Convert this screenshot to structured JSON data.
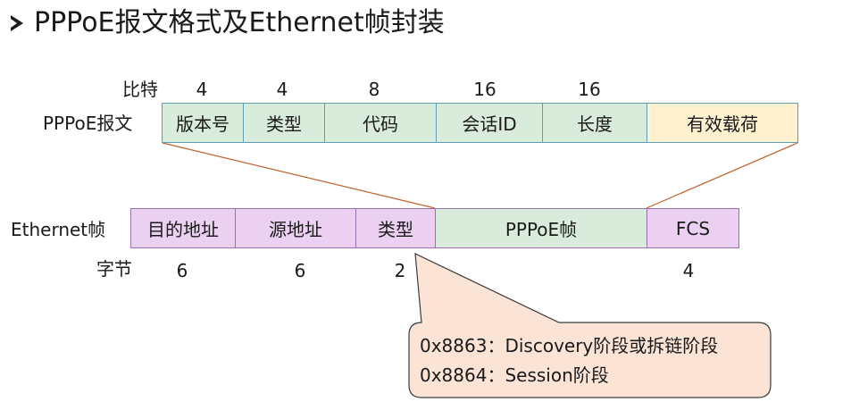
{
  "title": "PPPoE报文格式及Ethernet帧封装",
  "pppoe": {
    "row_label": "PPPoE报文",
    "bits_label": "比特",
    "bits": [
      "4",
      "4",
      "8",
      "16",
      "16"
    ],
    "fields": [
      "版本号",
      "类型",
      "代码",
      "会话ID",
      "长度",
      "有效载荷"
    ]
  },
  "ethernet": {
    "row_label": "Ethernet帧",
    "bytes_label": "字节",
    "bytes": [
      "6",
      "6",
      "2",
      "4"
    ],
    "fields": [
      "目的地址",
      "源地址",
      "类型",
      "PPPoE帧",
      "FCS"
    ]
  },
  "callout": {
    "line1": "0x8863：Discovery阶段或拆链阶段",
    "line2": "0x8864：Session阶段"
  },
  "colors": {
    "green": "#d9ecdc",
    "yellow": "#fdf1cf",
    "pink": "#ebd0f1",
    "callout_fill": "#fbe3d6",
    "line": "#c0622b"
  }
}
